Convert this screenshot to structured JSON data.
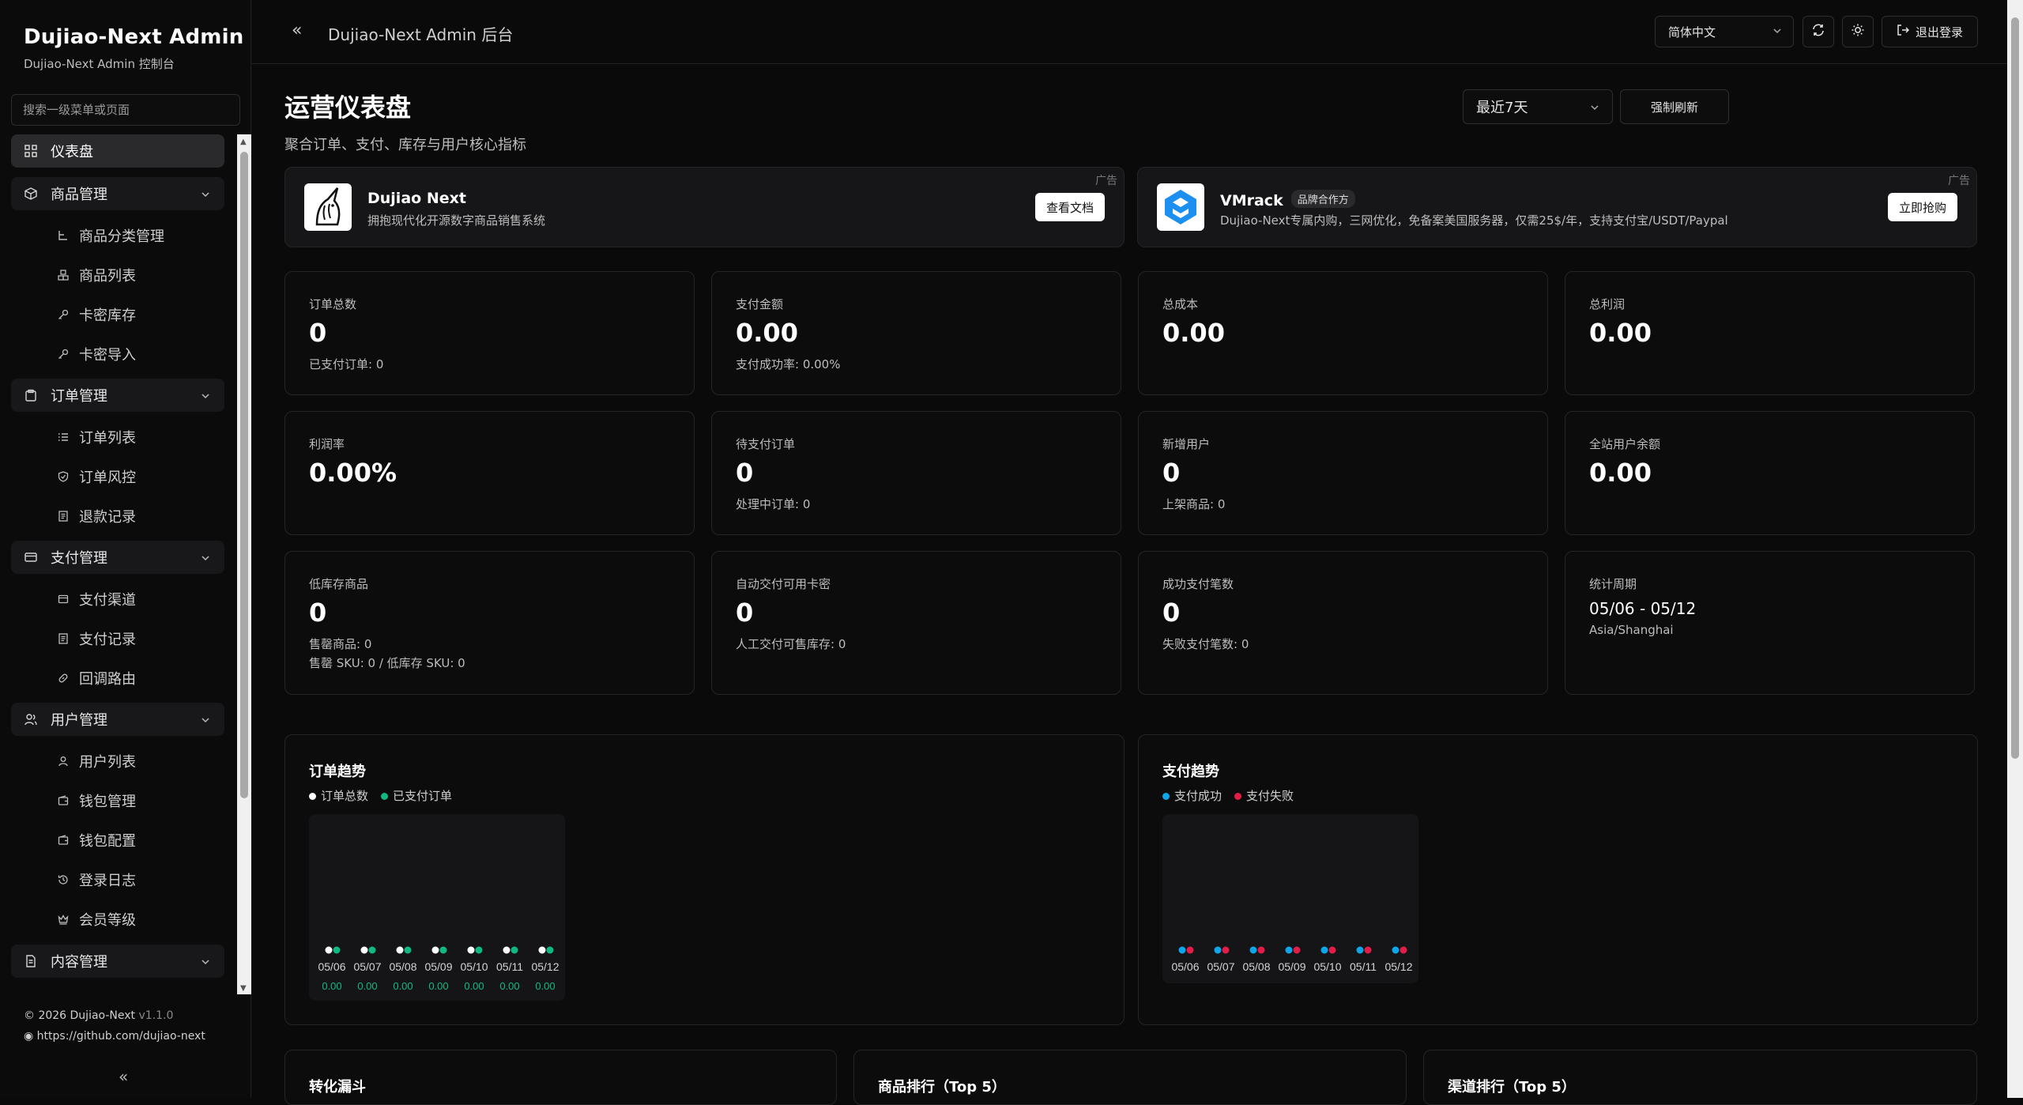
{
  "brand": {
    "title": "Dujiao-Next Admin",
    "subtitle": "Dujiao-Next Admin 控制台"
  },
  "search": {
    "placeholder": "搜索一级菜单或页面"
  },
  "sidebar": {
    "dashboard": "仪表盘",
    "products": {
      "label": "商品管理",
      "items": [
        "商品分类管理",
        "商品列表",
        "卡密库存",
        "卡密导入"
      ]
    },
    "orders": {
      "label": "订单管理",
      "items": [
        "订单列表",
        "订单风控",
        "退款记录"
      ]
    },
    "payments": {
      "label": "支付管理",
      "items": [
        "支付渠道",
        "支付记录",
        "回调路由"
      ]
    },
    "users": {
      "label": "用户管理",
      "items": [
        "用户列表",
        "钱包管理",
        "钱包配置",
        "登录日志",
        "会员等级"
      ]
    },
    "content": {
      "label": "内容管理"
    }
  },
  "footer": {
    "copyright": "© 2026 Dujiao-Next",
    "version": "v1.1.0",
    "github": "https://github.com/dujiao-next"
  },
  "topbar": {
    "title": "Dujiao-Next Admin 后台",
    "language": "简体中文",
    "logout": "退出登录"
  },
  "page": {
    "title": "运营仪表盘",
    "subtitle": "聚合订单、支付、库存与用户核心指标",
    "range": "最近7天",
    "force_refresh": "强制刷新"
  },
  "ads": [
    {
      "tag": "广告",
      "name": "Dujiao Next",
      "badge": "",
      "desc": "拥抱现代化开源数字商品销售系统",
      "cta": "查看文档"
    },
    {
      "tag": "广告",
      "name": "VMrack",
      "badge": "品牌合作方",
      "desc": "Dujiao-Next专属内购，三网优化，免备案美国服务器，仅需25$/年，支持支付宝/USDT/Paypal",
      "cta": "立即抢购"
    }
  ],
  "metrics": {
    "order_total": {
      "label": "订单总数",
      "value": "0",
      "sub": "已支付订单: 0"
    },
    "pay_amount": {
      "label": "支付金额",
      "value": "0.00",
      "sub": "支付成功率: 0.00%"
    },
    "total_cost": {
      "label": "总成本",
      "value": "0.00"
    },
    "total_profit": {
      "label": "总利润",
      "value": "0.00"
    },
    "profit_rate": {
      "label": "利润率",
      "value": "0.00%"
    },
    "pending_orders": {
      "label": "待支付订单",
      "value": "0",
      "sub": "处理中订单: 0"
    },
    "new_users": {
      "label": "新增用户",
      "value": "0",
      "sub": "上架商品: 0"
    },
    "user_balance": {
      "label": "全站用户余额",
      "value": "0.00"
    },
    "low_stock": {
      "label": "低库存商品",
      "value": "0",
      "sub": "售罄商品: 0",
      "sub2": "售罄 SKU: 0 / 低库存 SKU: 0"
    },
    "auto_cards": {
      "label": "自动交付可用卡密",
      "value": "0",
      "sub": "人工交付可售库存: 0"
    },
    "success_payments": {
      "label": "成功支付笔数",
      "value": "0",
      "sub": "失败支付笔数: 0"
    },
    "period": {
      "label": "统计周期",
      "value": "05/06 - 05/12",
      "tz": "Asia/Shanghai"
    }
  },
  "charts": {
    "orders_title": "订单趋势",
    "payments_title": "支付趋势",
    "bottom": {
      "funnel": "转化漏斗",
      "product_rank": "商品排行（Top 5）",
      "channel_rank": "渠道排行（Top 5）"
    }
  },
  "colors": {
    "accent_green": "#10b981",
    "accent_red": "#e11d48",
    "accent_blue": "#0ea5e9",
    "white": "#ffffff"
  },
  "chart_data": [
    {
      "type": "scatter",
      "title": "订单趋势",
      "categories": [
        "05/06",
        "05/07",
        "05/08",
        "05/09",
        "05/10",
        "05/11",
        "05/12"
      ],
      "series": [
        {
          "name": "订单总数",
          "color": "#ffffff",
          "values": [
            0,
            0,
            0,
            0,
            0,
            0,
            0
          ]
        },
        {
          "name": "已支付订单",
          "color": "#10b981",
          "values": [
            0,
            0,
            0,
            0,
            0,
            0,
            0
          ]
        }
      ],
      "data_labels": [
        "0.00",
        "0.00",
        "0.00",
        "0.00",
        "0.00",
        "0.00",
        "0.00"
      ]
    },
    {
      "type": "scatter",
      "title": "支付趋势",
      "categories": [
        "05/06",
        "05/07",
        "05/08",
        "05/09",
        "05/10",
        "05/11",
        "05/12"
      ],
      "series": [
        {
          "name": "支付成功",
          "color": "#0ea5e9",
          "values": [
            0,
            0,
            0,
            0,
            0,
            0,
            0
          ]
        },
        {
          "name": "支付失败",
          "color": "#e11d48",
          "values": [
            0,
            0,
            0,
            0,
            0,
            0,
            0
          ]
        }
      ]
    }
  ]
}
